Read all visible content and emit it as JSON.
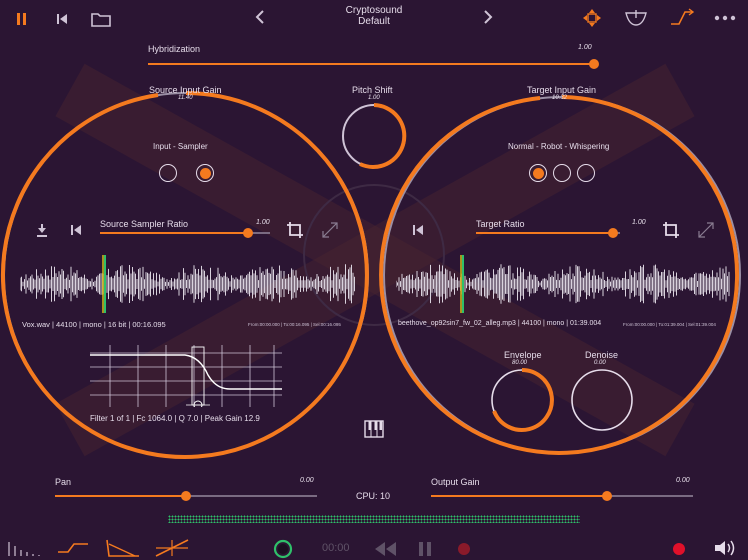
{
  "colors": {
    "accent": "#f47a1f",
    "background": "#2b1533",
    "ring": "#9b8fa5"
  },
  "header": {
    "app_name": "Cryptosound",
    "preset": "Default"
  },
  "hybridization": {
    "label": "Hybridization",
    "value": "1.00",
    "level": 1.0
  },
  "source_input_gain": {
    "label": "Source Input Gain",
    "value": "11.40"
  },
  "pitch_shift": {
    "label": "Pitch Shift",
    "value": "1.00"
  },
  "target_input_gain": {
    "label": "Target Input Gain",
    "value": "10.32"
  },
  "source_panel": {
    "mode_label": "Input  -  Sampler",
    "ratio_label": "Source Sampler Ratio",
    "ratio_value": "1.00",
    "ratio_level": 0.87,
    "file_info": "Vox.wav | 44100 | mono | 16 bit | 00:16.095",
    "range_info": "From:00:00.000 | To:00:16.095 | Sel:00:16.095",
    "filter_info": "Filter 1 of 1 | Fc 1064.0 | Q 7.0 | Peak Gain 12.9"
  },
  "target_panel": {
    "mode_label": "Normal - Robot - Whispering",
    "ratio_label": "Target Ratio",
    "ratio_value": "1.00",
    "ratio_level": 0.95,
    "file_info": "beethove_op92sin7_fw_02_alleg.mp3 | 44100 | mono | 01:39.004",
    "range_info": "From:00:00.000 | To:01:39.004 | Sel:01:39.004",
    "envelope_label": "Envelope",
    "envelope_value": "80.00",
    "denoise_label": "Denoise",
    "denoise_value": "0.00"
  },
  "pan": {
    "label": "Pan",
    "value": "0.00",
    "level": 0.5
  },
  "output_gain": {
    "label": "Output Gain",
    "value": "0.00",
    "level": 0.67
  },
  "cpu": "CPU: 10",
  "transport": {
    "time": "00:00"
  },
  "icons": [
    "pause-icon",
    "skip-back-icon",
    "folder-icon",
    "chevron-left-icon",
    "chevron-right-icon",
    "move-arrows-icon",
    "filter-bowl-icon",
    "curve-icon",
    "more-icon",
    "crop-icon",
    "expand-icon",
    "piano-icon",
    "rewind-icon",
    "record-icon",
    "speaker-icon"
  ]
}
